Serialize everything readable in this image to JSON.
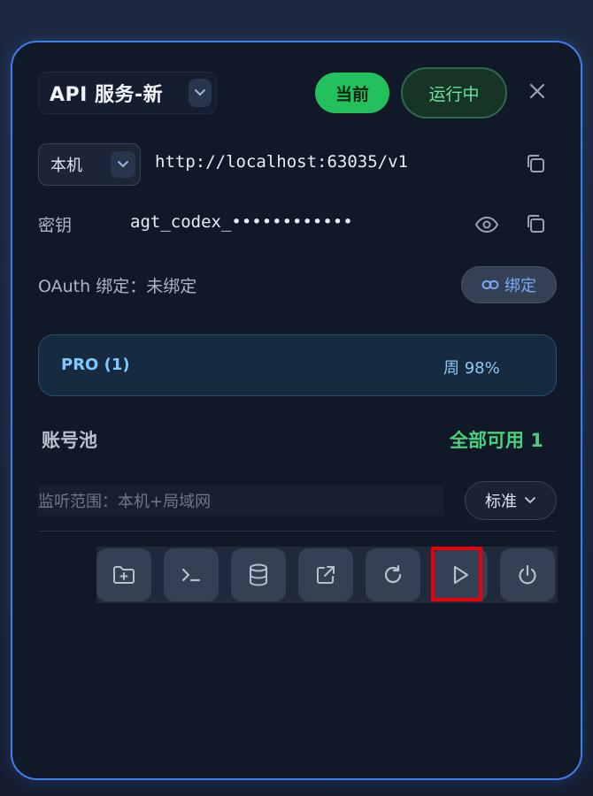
{
  "header": {
    "service_name": "API 服务-新",
    "current_badge": "当前",
    "running_badge": "运行中"
  },
  "endpoint": {
    "host_option": "本机",
    "url": "http://localhost:63035/v1"
  },
  "key": {
    "label": "密钥",
    "value": "agt_codex_••••••••••••"
  },
  "oauth": {
    "label": "OAuth 绑定：未绑定",
    "bind_button": "绑定"
  },
  "plan": {
    "label": "PRO (1)",
    "weekly": "周 98%"
  },
  "pool": {
    "label": "账号池",
    "status": "全部可用 1"
  },
  "listen": {
    "value": "监听范围：本机+局域网",
    "mode": "标准"
  },
  "toolbar": {
    "buttons": [
      "folder-plus-icon",
      "terminal-icon",
      "database-icon",
      "external-link-icon",
      "refresh-icon",
      "play-icon",
      "power-icon"
    ]
  },
  "colors": {
    "accent_border": "#3f7ee8",
    "current_badge": "#22c15e",
    "running_text": "#6fe39b",
    "pool_status": "#48d17e",
    "highlight": "#e8000c"
  }
}
